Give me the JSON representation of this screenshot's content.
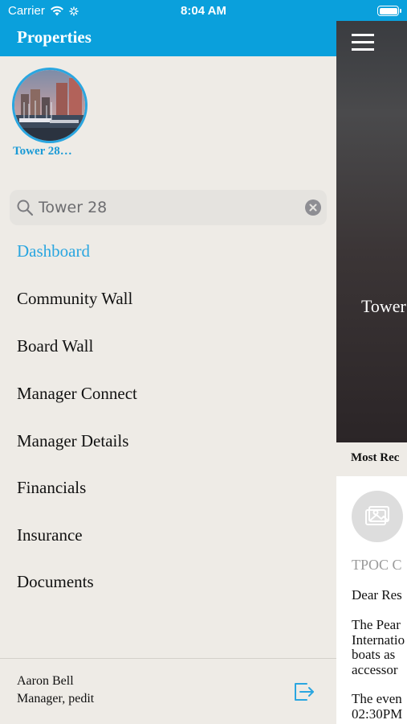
{
  "status_bar": {
    "carrier": "Carrier",
    "time": "8:04 AM"
  },
  "side_menu": {
    "title": "Properties",
    "property": {
      "name": "Tower 28…"
    },
    "search": {
      "value": "Tower 28",
      "placeholder": "Search"
    },
    "items": [
      {
        "label": "Dashboard",
        "active": true
      },
      {
        "label": "Community Wall",
        "active": false
      },
      {
        "label": "Board Wall",
        "active": false
      },
      {
        "label": "Manager Connect",
        "active": false
      },
      {
        "label": "Manager Details",
        "active": false
      },
      {
        "label": "Financials",
        "active": false
      },
      {
        "label": "Insurance",
        "active": false
      },
      {
        "label": "Documents",
        "active": false
      }
    ],
    "footer": {
      "user_name": "Aaron Bell",
      "user_role": "Manager, pedit"
    }
  },
  "main": {
    "hero_title": "Tower",
    "section_title": "Most Rec",
    "post": {
      "author": "TPOC C",
      "greeting": "Dear Res",
      "body_lines": [
        "The Pear",
        "Internatio",
        "boats as",
        "accessor"
      ],
      "body2_lines": [
        "The even",
        "02:30PM"
      ]
    }
  },
  "colors": {
    "accent": "#0aa0dc",
    "active_item": "#2aa6e0",
    "menu_background": "#eeebe6"
  }
}
